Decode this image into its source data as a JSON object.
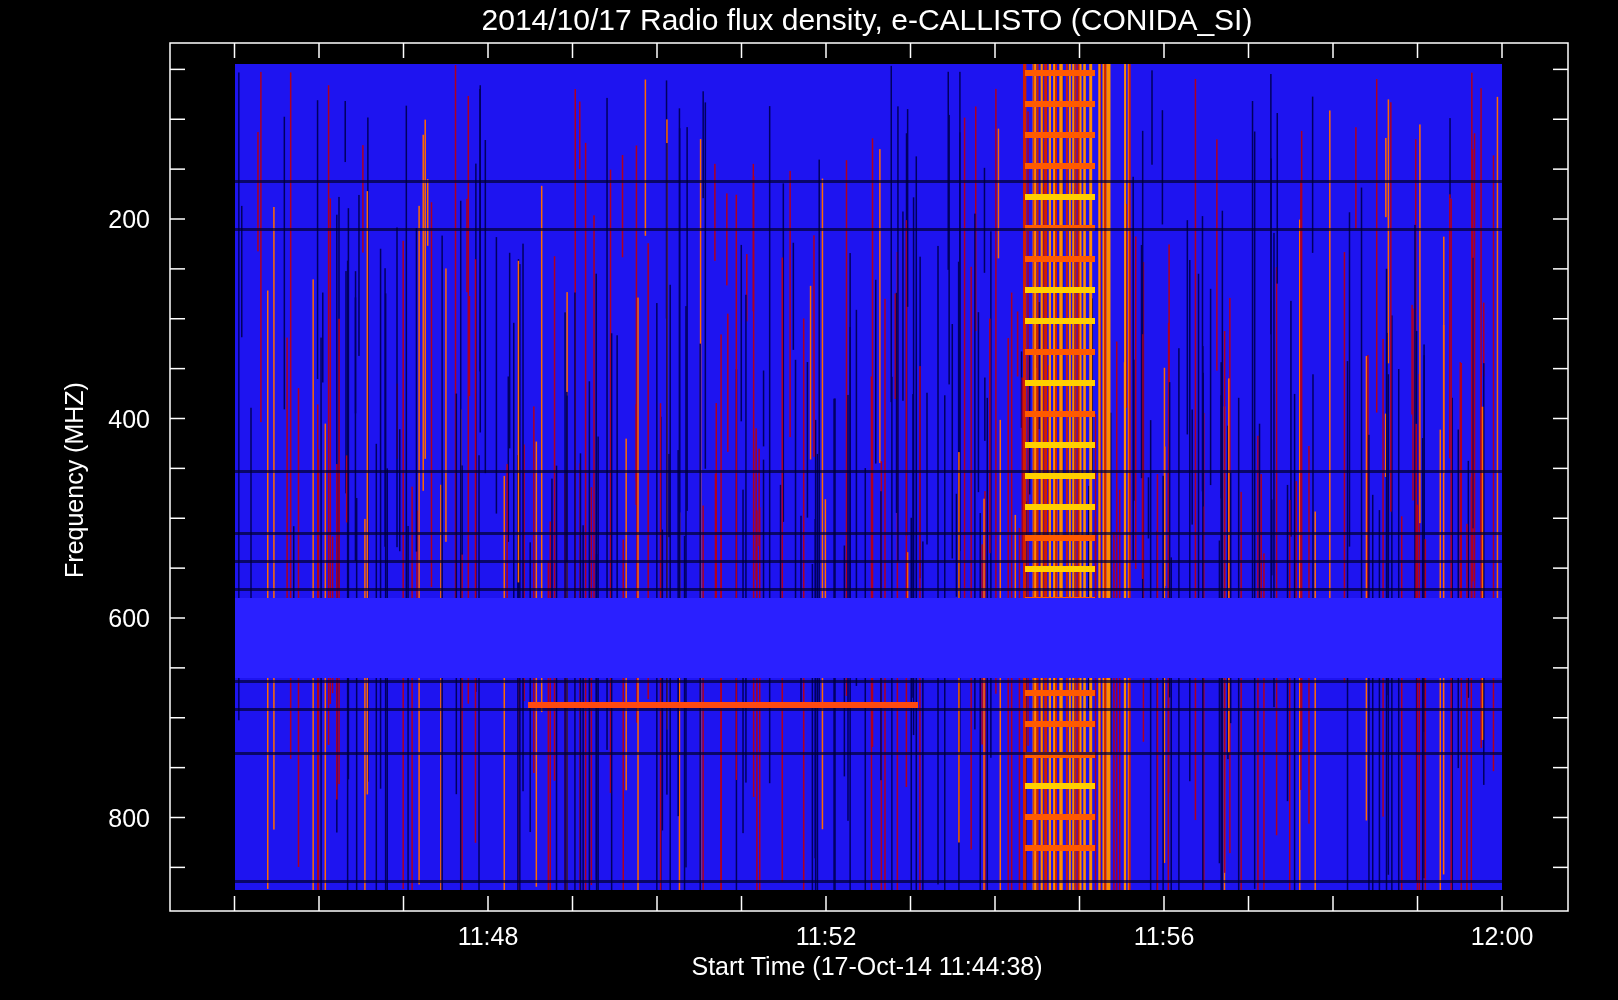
{
  "title": "2014/10/17  Radio flux density, e-CALLISTO (CONIDA_SI)",
  "y_axis": {
    "label": "Frequency (MHZ)",
    "ticks": [
      "200",
      "400",
      "600",
      "800"
    ]
  },
  "x_axis": {
    "label": "Start Time (17-Oct-14 11:44:38)",
    "ticks": [
      "11:48",
      "11:52",
      "11:56",
      "12:00"
    ]
  }
}
